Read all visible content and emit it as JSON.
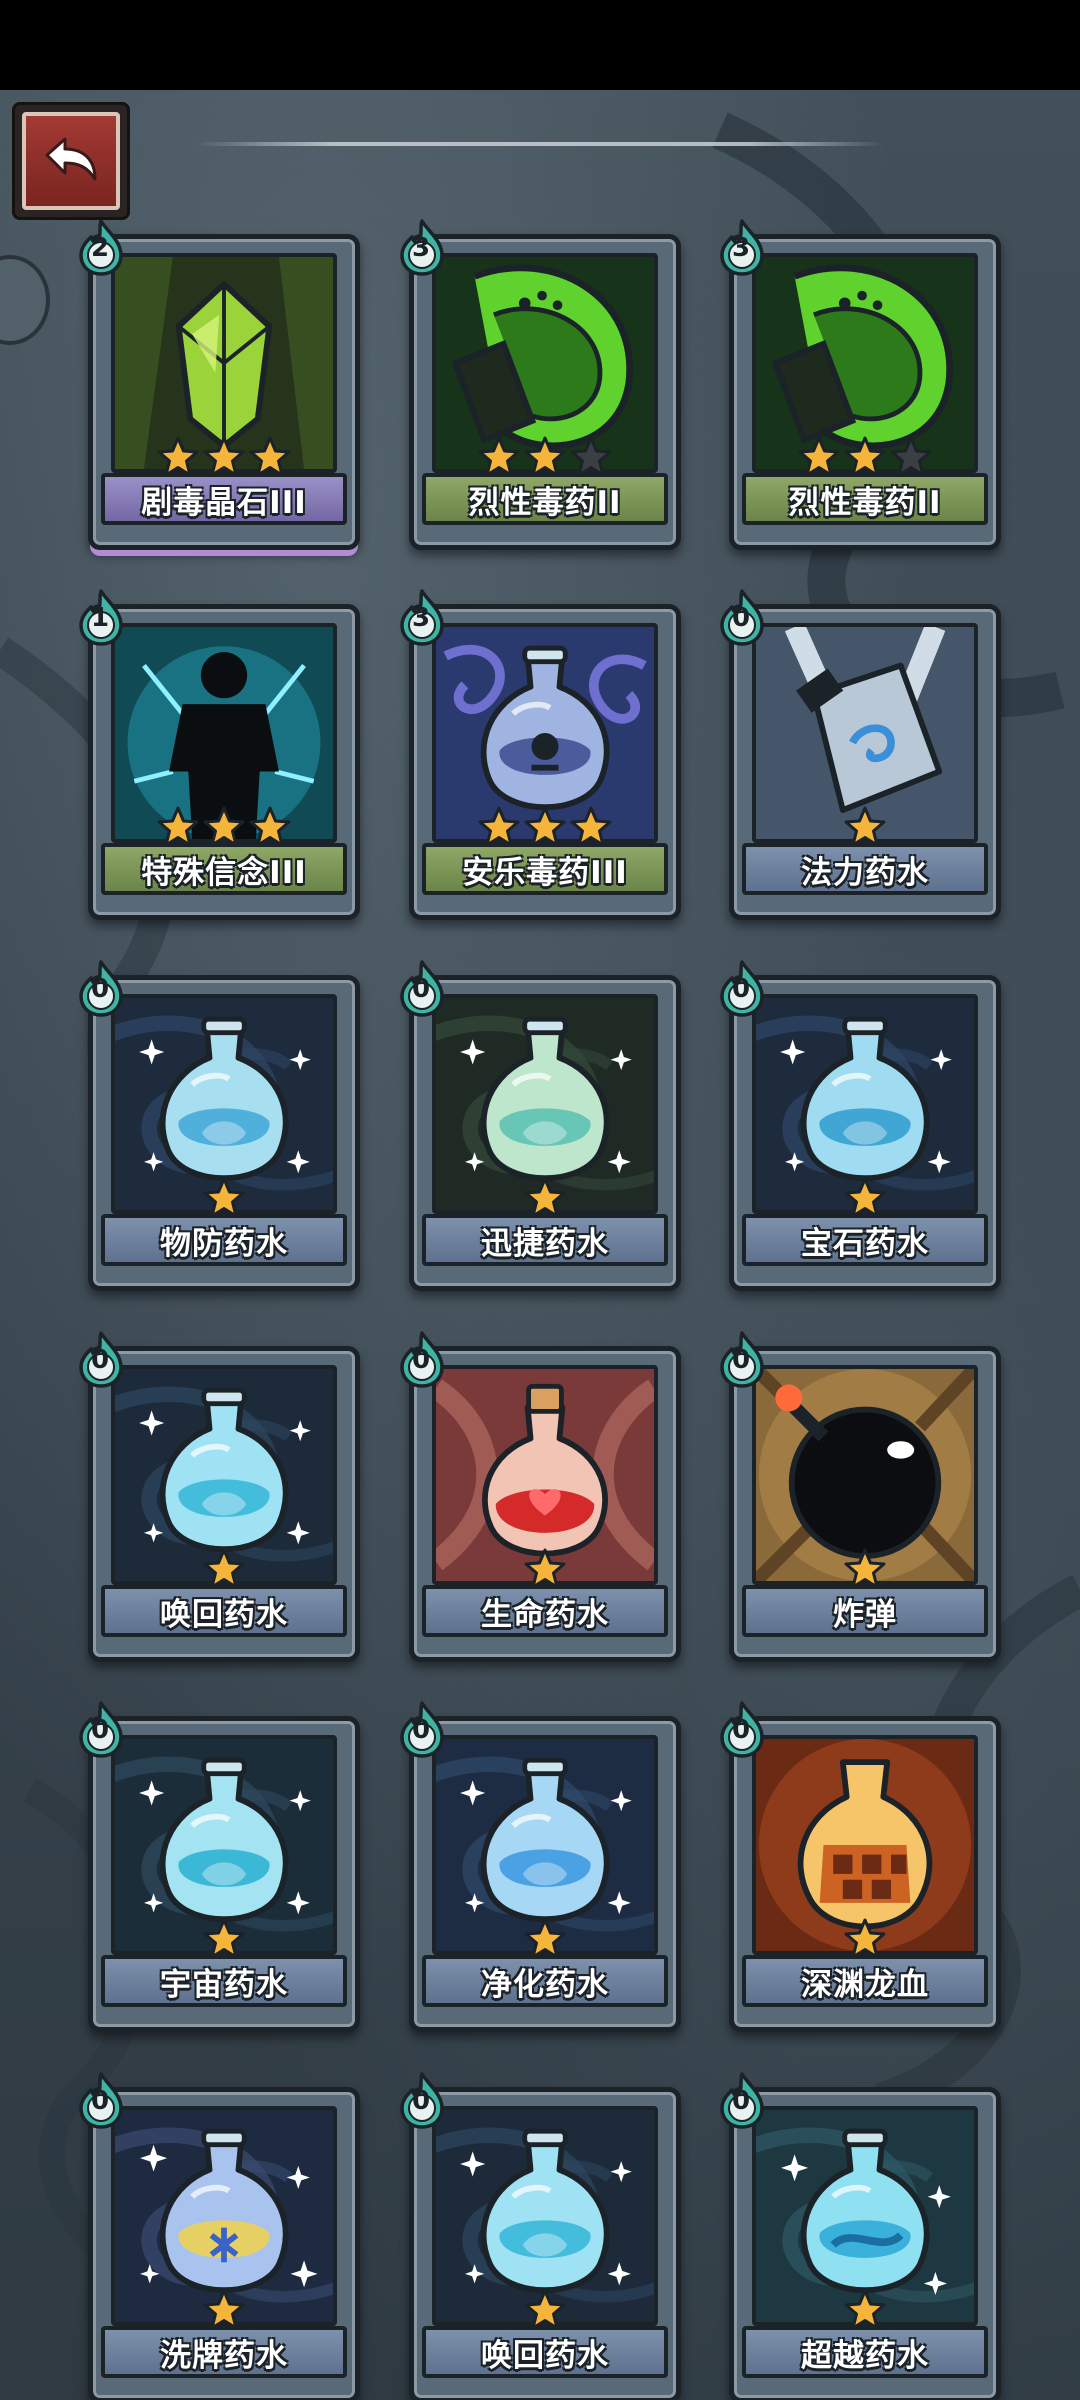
{
  "header": {
    "back_button": "back-arrow-icon"
  },
  "colors": {
    "name_bar_green": "#7b9658",
    "name_bar_purple": "#8a7fbc",
    "name_bar_blue": "#6b7f9c",
    "star_gold": "#f4b53a",
    "star_empty": "#3a3f45",
    "cost_drop": "#3fb3a4"
  },
  "cards": [
    {
      "name": "剧毒晶石III",
      "cost": "2",
      "stars": 3,
      "max_stars": 3,
      "bar": "purple",
      "icon": "poison-crystal-icon"
    },
    {
      "name": "烈性毒药II",
      "cost": "3",
      "stars": 2,
      "max_stars": 3,
      "bar": "green",
      "icon": "poison-splash-icon"
    },
    {
      "name": "烈性毒药II",
      "cost": "3",
      "stars": 2,
      "max_stars": 3,
      "bar": "green",
      "icon": "poison-splash-icon"
    },
    {
      "name": "特殊信念III",
      "cost": "1",
      "stars": 3,
      "max_stars": 3,
      "bar": "green",
      "icon": "hero-silhouette-icon"
    },
    {
      "name": "安乐毒药III",
      "cost": "3",
      "stars": 3,
      "max_stars": 3,
      "bar": "green",
      "icon": "skull-flask-icon"
    },
    {
      "name": "法力药水",
      "cost": "0",
      "stars": 1,
      "max_stars": 1,
      "bar": "blue",
      "icon": "mana-potion-icon"
    },
    {
      "name": "物防药水",
      "cost": "0",
      "stars": 1,
      "max_stars": 1,
      "bar": "blue",
      "icon": "defense-potion-icon"
    },
    {
      "name": "迅捷药水",
      "cost": "0",
      "stars": 1,
      "max_stars": 1,
      "bar": "blue",
      "icon": "swift-potion-icon"
    },
    {
      "name": "宝石药水",
      "cost": "0",
      "stars": 1,
      "max_stars": 1,
      "bar": "blue",
      "icon": "gem-potion-icon"
    },
    {
      "name": "唤回药水",
      "cost": "0",
      "stars": 1,
      "max_stars": 1,
      "bar": "blue",
      "icon": "recall-potion-icon"
    },
    {
      "name": "生命药水",
      "cost": "0",
      "stars": 1,
      "max_stars": 1,
      "bar": "blue",
      "icon": "health-potion-icon"
    },
    {
      "name": "炸弹",
      "cost": "0",
      "stars": 1,
      "max_stars": 1,
      "bar": "blue",
      "icon": "bomb-icon"
    },
    {
      "name": "宇宙药水",
      "cost": "0",
      "stars": 1,
      "max_stars": 1,
      "bar": "blue",
      "icon": "cosmic-potion-icon"
    },
    {
      "name": "净化药水",
      "cost": "0",
      "stars": 1,
      "max_stars": 1,
      "bar": "blue",
      "icon": "purify-potion-icon"
    },
    {
      "name": "深渊龙血",
      "cost": "0",
      "stars": 1,
      "max_stars": 1,
      "bar": "blue",
      "icon": "dragon-blood-icon"
    },
    {
      "name": "洗牌药水",
      "cost": "0",
      "stars": 1,
      "max_stars": 1,
      "bar": "blue",
      "icon": "shuffle-potion-icon"
    },
    {
      "name": "唤回药水",
      "cost": "0",
      "stars": 1,
      "max_stars": 1,
      "bar": "blue",
      "icon": "recall-potion-icon"
    },
    {
      "name": "超越药水",
      "cost": "0",
      "stars": 1,
      "max_stars": 1,
      "bar": "blue",
      "icon": "transcend-potion-icon"
    }
  ]
}
